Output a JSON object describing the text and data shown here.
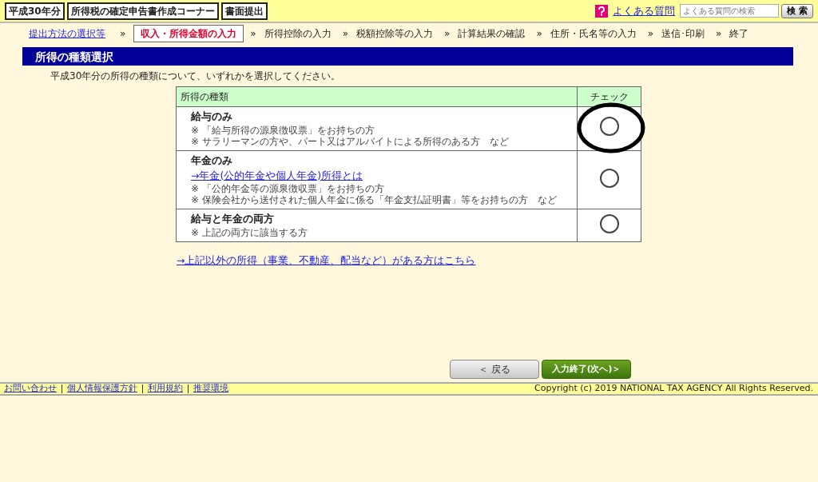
{
  "header": {
    "badges": [
      "平成30年分",
      "所得税の確定申告書作成コーナー",
      "書面提出"
    ],
    "help_link": "よくある質問",
    "search": {
      "placeholder": "よくある質問の検索",
      "button": "検 索"
    }
  },
  "steps": [
    {
      "label": "提出方法の選択等",
      "kind": "link",
      "selected": false
    },
    {
      "label": "»",
      "kind": "sep",
      "selected": false
    },
    {
      "label": "収入・所得金額の入力",
      "kind": "step",
      "selected": true
    },
    {
      "label": "»",
      "kind": "sep",
      "selected": false
    },
    {
      "label": "所得控除の入力",
      "kind": "step",
      "selected": false
    },
    {
      "label": "»",
      "kind": "sep",
      "selected": false
    },
    {
      "label": "税額控除等の入力",
      "kind": "step",
      "selected": false
    },
    {
      "label": "»",
      "kind": "sep",
      "selected": false
    },
    {
      "label": "計算結果の確認",
      "kind": "step",
      "selected": false
    },
    {
      "label": "»",
      "kind": "sep",
      "selected": false
    },
    {
      "label": "住所・氏名等の入力",
      "kind": "step",
      "selected": false
    },
    {
      "label": "»",
      "kind": "sep",
      "selected": false
    },
    {
      "label": "送信･印刷",
      "kind": "step",
      "selected": false
    },
    {
      "label": "»",
      "kind": "sep",
      "selected": false
    },
    {
      "label": "終了",
      "kind": "step",
      "selected": false
    }
  ],
  "section_title": "所得の種類選択",
  "intro": "平成30年分の所得の種類について、いずれかを選択してください。",
  "table": {
    "columns": [
      "所得の種類",
      "チェック"
    ],
    "rows": [
      {
        "title": "給与のみ",
        "link": null,
        "notes": [
          "※ 「給与所得の源泉徴収票」をお持ちの方",
          "※ サラリーマンの方や、パート又はアルバイトによる所得のある方　など"
        ],
        "selected": false,
        "circled": true
      },
      {
        "title": "年金のみ",
        "link": "→年金(公的年金や個人年金)所得とは",
        "notes": [
          "※ 「公的年金等の源泉徴収票」をお持ちの方",
          "※ 保険会社から送付された個人年金に係る「年金支払証明書」等をお持ちの方　など"
        ],
        "selected": false,
        "circled": false
      },
      {
        "title": "給与と年金の両方",
        "link": null,
        "notes": [
          "※ 上記の両方に該当する方"
        ],
        "selected": false,
        "circled": false
      }
    ]
  },
  "other_link": "→上記以外の所得（事業、不動産、配当など）がある方はこちら",
  "buttons": {
    "back": "＜ 戻る",
    "next": "入力終了(次へ)＞"
  },
  "footer": {
    "links": [
      "お問い合わせ",
      "個人情報保護方針",
      "利用規約",
      "推奨環境"
    ],
    "copyright": "Copyright (c) 2019 NATIONAL TAX AGENCY All Rights Reserved."
  }
}
